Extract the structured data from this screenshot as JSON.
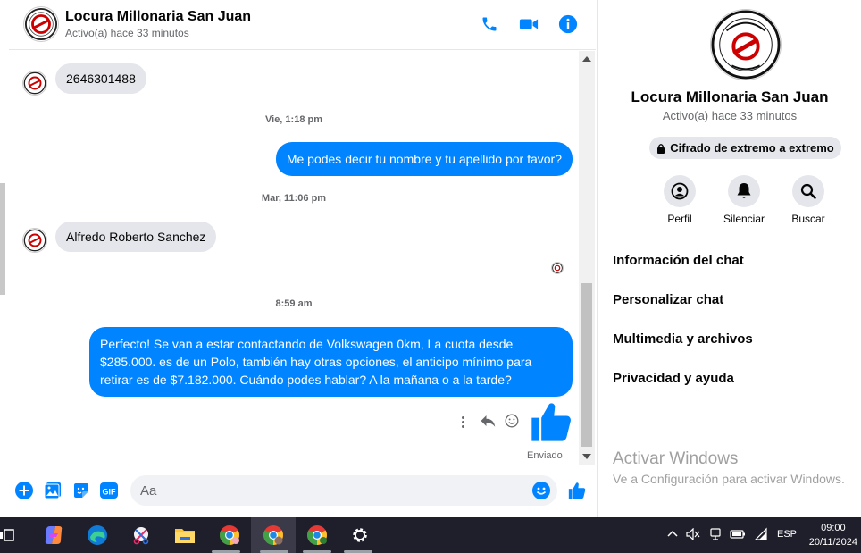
{
  "header": {
    "title": "Locura Millonaria San Juan",
    "status": "Activo(a) hace 33 minutos"
  },
  "messages": [
    {
      "type": "in",
      "text": "2646301488"
    },
    {
      "type": "time",
      "text": "Vie, 1:18 pm"
    },
    {
      "type": "out",
      "text": "Me podes decir tu nombre y tu apellido por favor?"
    },
    {
      "type": "time",
      "text": "Mar, 11:06 pm"
    },
    {
      "type": "in",
      "text": "Alfredo Roberto Sanchez"
    },
    {
      "type": "time",
      "text": "8:59 am"
    },
    {
      "type": "out",
      "text": "Perfecto!  Se van a estar contactando de Volkswagen 0km, La cuota desde $285.000. es de un Polo, también hay otras opciones, el anticipo mínimo para retirar es de $7.182.000. Cuándo podes hablar? A la mañana o a la tarde?"
    }
  ],
  "sent_label": "Enviado",
  "composer": {
    "placeholder": "Aa"
  },
  "right_panel": {
    "name": "Locura Millonaria San Juan",
    "status": "Activo(a) hace 33 minutos",
    "encryption": "Cifrado de extremo a extremo",
    "actions": [
      "Perfil",
      "Silenciar",
      "Buscar"
    ],
    "menu": [
      "Información del chat",
      "Personalizar chat",
      "Multimedia y archivos",
      "Privacidad y ayuda"
    ],
    "watermark_title": "Activar Windows",
    "watermark_sub": "Ve a Configuración para activar Windows."
  },
  "colors": {
    "accent": "#0084ff",
    "incoming_bubble": "#e4e6eb",
    "taskbar": "#1f1f2b"
  },
  "taskbar": {
    "language": "ESP",
    "time": "09:00",
    "date": "20/11/2024"
  }
}
